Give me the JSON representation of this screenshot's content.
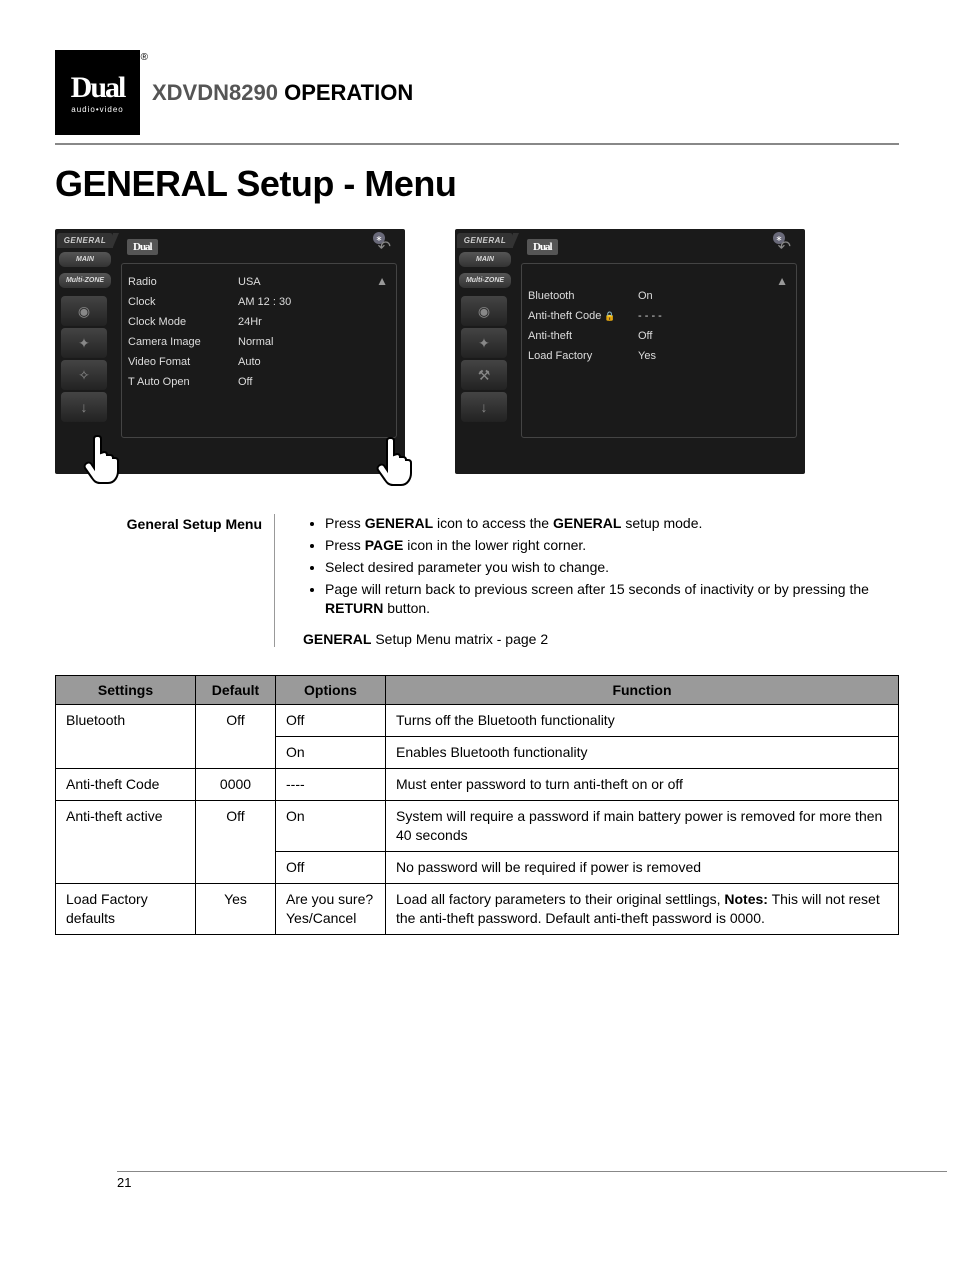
{
  "logo": {
    "main": "Dual",
    "sub": "audio•video",
    "reg": "®"
  },
  "header": {
    "model": "XDVDN8290",
    "word": "OPERATION"
  },
  "page_title": "GENERAL Setup - Menu",
  "screen_common": {
    "tab_general": "GENERAL",
    "tab_main": "MAIN",
    "tab_multizone": "Multi-ZONE",
    "dual": "Dual",
    "bt": "∗"
  },
  "screen1": {
    "rows": [
      {
        "lbl": "Radio",
        "val": "USA"
      },
      {
        "lbl": "Clock",
        "val": "AM  12 : 30"
      },
      {
        "lbl": "Clock  Mode",
        "val": "24Hr"
      },
      {
        "lbl": "Camera Image",
        "val": "Normal"
      },
      {
        "lbl": "Video  Fomat",
        "val": "Auto"
      },
      {
        "lbl": "T Auto Open",
        "val": "Off"
      }
    ]
  },
  "screen2": {
    "rows": [
      {
        "lbl": "Bluetooth",
        "val": "On",
        "lock": false
      },
      {
        "lbl": "Anti-theft Code",
        "val": "- - - -",
        "lock": true
      },
      {
        "lbl": "Anti-theft",
        "val": "Off",
        "lock": false
      },
      {
        "lbl": "Load  Factory",
        "val": "Yes",
        "lock": false
      }
    ]
  },
  "desc": {
    "label": "General Setup Menu",
    "bullets": [
      {
        "pre": "Press ",
        "b1": "GENERAL",
        "mid": " icon to access the ",
        "b2": "GENERAL",
        "post": " setup mode."
      },
      {
        "pre": "Press ",
        "b1": "PAGE",
        "mid": " icon in the lower right corner.",
        "b2": "",
        "post": ""
      },
      {
        "pre": "Select desired parameter you wish to change.",
        "b1": "",
        "mid": "",
        "b2": "",
        "post": ""
      },
      {
        "pre": "Page will return back to previous screen after 15 seconds of inactivity or by pressing the ",
        "b1": "RETURN",
        "mid": " button.",
        "b2": "",
        "post": ""
      }
    ],
    "caption_b": "GENERAL",
    "caption_rest": " Setup Menu matrix - page 2"
  },
  "table": {
    "headers": [
      "Settings",
      "Default",
      "Options",
      "Function"
    ],
    "rows": [
      {
        "setting": "Bluetooth",
        "default": "Off",
        "option": "Off",
        "function": "Turns off the Bluetooth functionality",
        "rs_s": 2,
        "rs_d": 2
      },
      {
        "option": "On",
        "function": "Enables Bluetooth functionality"
      },
      {
        "setting": "Anti-theft Code",
        "default": "0000",
        "option": "----",
        "function": "Must enter password to turn anti-theft on or off",
        "rs_s": 1,
        "rs_d": 1
      },
      {
        "setting": "Anti-theft active",
        "default": "Off",
        "option": "On",
        "function": "System will require a password if main battery power is removed for more then 40 seconds",
        "rs_s": 2,
        "rs_d": 2
      },
      {
        "option": "Off",
        "function": "No password will be required if power is removed"
      },
      {
        "setting": "Load Factory defaults",
        "default": "Yes",
        "option": "Are you sure? Yes/Cancel",
        "function_html": true,
        "function_pre": "Load all factory parameters to their original settlings, ",
        "function_b": "Notes:",
        "function_post": " This will not reset the anti-theft password. Default anti-theft password is 0000.",
        "rs_s": 1,
        "rs_d": 1
      }
    ]
  },
  "page_number": "21"
}
